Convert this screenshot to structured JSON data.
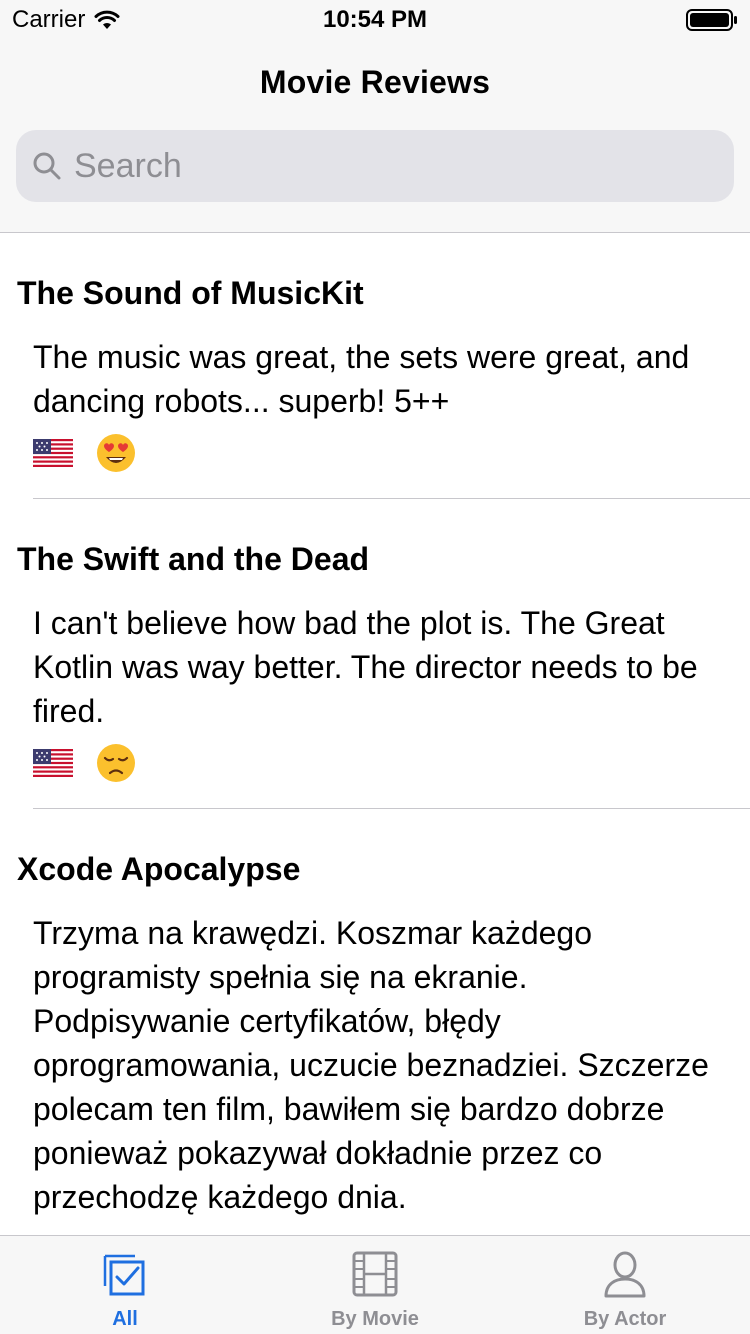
{
  "status_bar": {
    "carrier": "Carrier",
    "time": "10:54 PM"
  },
  "header": {
    "title": "Movie Reviews"
  },
  "search": {
    "placeholder": "Search",
    "value": ""
  },
  "reviews": [
    {
      "title": "The Sound of MusicKit",
      "body": "The music was great, the sets were great, and dancing robots... superb! 5++",
      "flag_icon": "us-flag-icon",
      "emoji_icon": "heart-eyes-emoji-icon"
    },
    {
      "title": "The Swift and the Dead",
      "body": "I can't believe how bad the plot is. The Great Kotlin was way better. The director needs to be fired.",
      "flag_icon": "us-flag-icon",
      "emoji_icon": "disappointed-emoji-icon"
    },
    {
      "title": "Xcode Apocalypse",
      "body": "Trzyma na krawędzi. Koszmar każdego programisty spełnia się na ekranie. Podpisywanie certyfikatów, błędy oprogramowania, uczucie beznadziei. Szczerze polecam ten film, bawiłem się bardzo dobrze ponieważ pokazywał dokładnie przez co przechodzę każdego dnia."
    }
  ],
  "tabs": [
    {
      "label": "All",
      "icon": "checklist-icon",
      "active": true
    },
    {
      "label": "By Movie",
      "icon": "film-icon",
      "active": false
    },
    {
      "label": "By Actor",
      "icon": "person-icon",
      "active": false
    }
  ],
  "colors": {
    "accent": "#1f6fe0",
    "inactive": "#8e8e93",
    "bar_background": "#f7f7f7",
    "search_background": "#e3e3e8"
  }
}
